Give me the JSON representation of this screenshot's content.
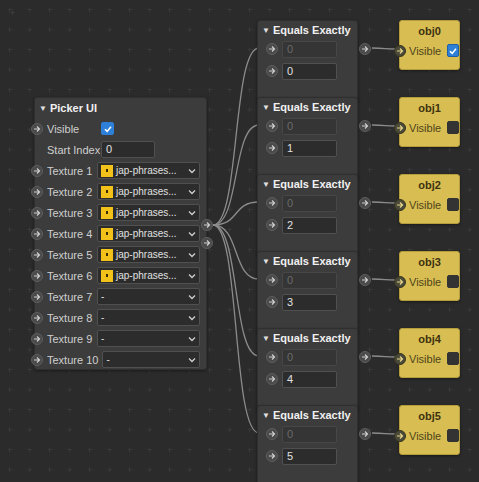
{
  "picker": {
    "collapse": "▼",
    "title": "Picker UI",
    "visible": {
      "label": "Visible",
      "checked": true
    },
    "start_index": {
      "label": "Start Index",
      "value": "0"
    },
    "textures": [
      {
        "label": "Texture 1",
        "value": "jap-phrases...",
        "kind": "asset"
      },
      {
        "label": "Texture 2",
        "value": "jap-phrases...",
        "kind": "asset"
      },
      {
        "label": "Texture 3",
        "value": "jap-phrases...",
        "kind": "asset"
      },
      {
        "label": "Texture 4",
        "value": "jap-phrases...",
        "kind": "asset"
      },
      {
        "label": "Texture 5",
        "value": "jap-phrases...",
        "kind": "asset"
      },
      {
        "label": "Texture 6",
        "value": "jap-phrases...",
        "kind": "asset"
      },
      {
        "label": "Texture 7",
        "value": "-",
        "kind": "none"
      },
      {
        "label": "Texture 8",
        "value": "-",
        "kind": "none"
      },
      {
        "label": "Texture 9",
        "value": "-",
        "kind": "none"
      },
      {
        "label": "Texture 10",
        "value": "-",
        "kind": "none"
      }
    ]
  },
  "comparisons": [
    {
      "collapse": "▼",
      "title": "Equals Exactly",
      "input_a": "0",
      "input_a_disabled": true,
      "input_b": "0"
    },
    {
      "collapse": "▼",
      "title": "Equals Exactly",
      "input_a": "0",
      "input_a_disabled": true,
      "input_b": "1"
    },
    {
      "collapse": "▼",
      "title": "Equals Exactly",
      "input_a": "0",
      "input_a_disabled": true,
      "input_b": "2"
    },
    {
      "collapse": "▼",
      "title": "Equals Exactly",
      "input_a": "0",
      "input_a_disabled": true,
      "input_b": "3"
    },
    {
      "collapse": "▼",
      "title": "Equals Exactly",
      "input_a": "0",
      "input_a_disabled": true,
      "input_b": "4"
    },
    {
      "collapse": "▼",
      "title": "Equals Exactly",
      "input_a": "0",
      "input_a_disabled": true,
      "input_b": "5"
    }
  ],
  "objects": [
    {
      "title": "obj0",
      "label": "Visible",
      "checked": true
    },
    {
      "title": "obj1",
      "label": "Visible",
      "checked": false
    },
    {
      "title": "obj2",
      "label": "Visible",
      "checked": false
    },
    {
      "title": "obj3",
      "label": "Visible",
      "checked": false
    },
    {
      "title": "obj4",
      "label": "Visible",
      "checked": false
    },
    {
      "title": "obj5",
      "label": "Visible",
      "checked": false
    }
  ]
}
